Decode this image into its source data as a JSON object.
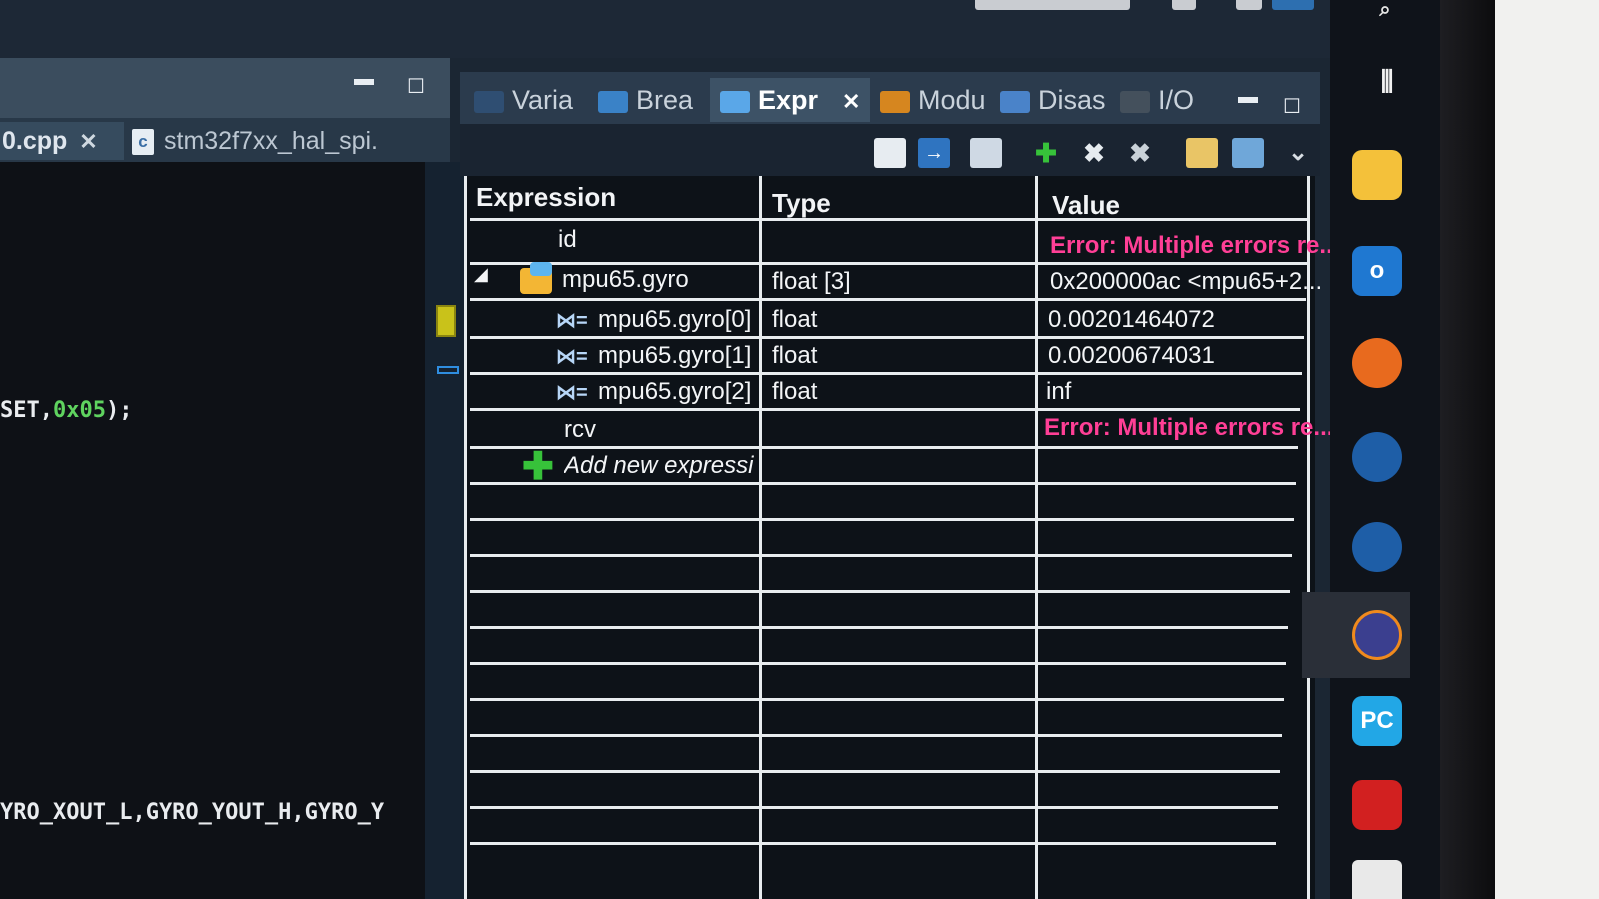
{
  "editor": {
    "active_tab": "0.cpp",
    "other_tab": "stm32f7xx_hal_spi.",
    "code_line_1": "SET,",
    "code_hex": "0x05",
    "code_tail": ");",
    "code_line_2": "YRO_XOUT_L,GYRO_YOUT_H,GYRO_Y"
  },
  "view_tabs": {
    "variables": "Varia",
    "breakpoints": "Brea",
    "expressions": "Expr",
    "modules": "Modu",
    "disassembly": "Disas",
    "io": "I/O"
  },
  "table": {
    "headers": {
      "expression": "Expression",
      "type": "Type",
      "value": "Value"
    },
    "rows": [
      {
        "expression": "id",
        "type": "",
        "value": "Error: Multiple errors re..."
      },
      {
        "expression": "mpu65.gyro",
        "type": "float [3]",
        "value": "0x200000ac <mpu65+2..."
      },
      {
        "expression": "mpu65.gyro[0]",
        "type": "float",
        "value": "0.00201464072"
      },
      {
        "expression": "mpu65.gyro[1]",
        "type": "float",
        "value": "0.00200674031"
      },
      {
        "expression": "mpu65.gyro[2]",
        "type": "float",
        "value": "inf"
      },
      {
        "expression": "rcv",
        "type": "",
        "value": "Error: Multiple errors re..."
      }
    ],
    "add_new": "Add new expressi"
  },
  "taskbar": {
    "apps": [
      "file-explorer-icon",
      "outlook-icon",
      "firefox-icon",
      "steam-icon",
      "steam-icon",
      "eclipse-icon",
      "pycharm-icon",
      "acrobat-icon"
    ],
    "pycharm_label": "PC"
  },
  "colors": {
    "error": "#ff3f96",
    "accent_green": "#37c23a",
    "hex_green": "#5fd35f"
  }
}
